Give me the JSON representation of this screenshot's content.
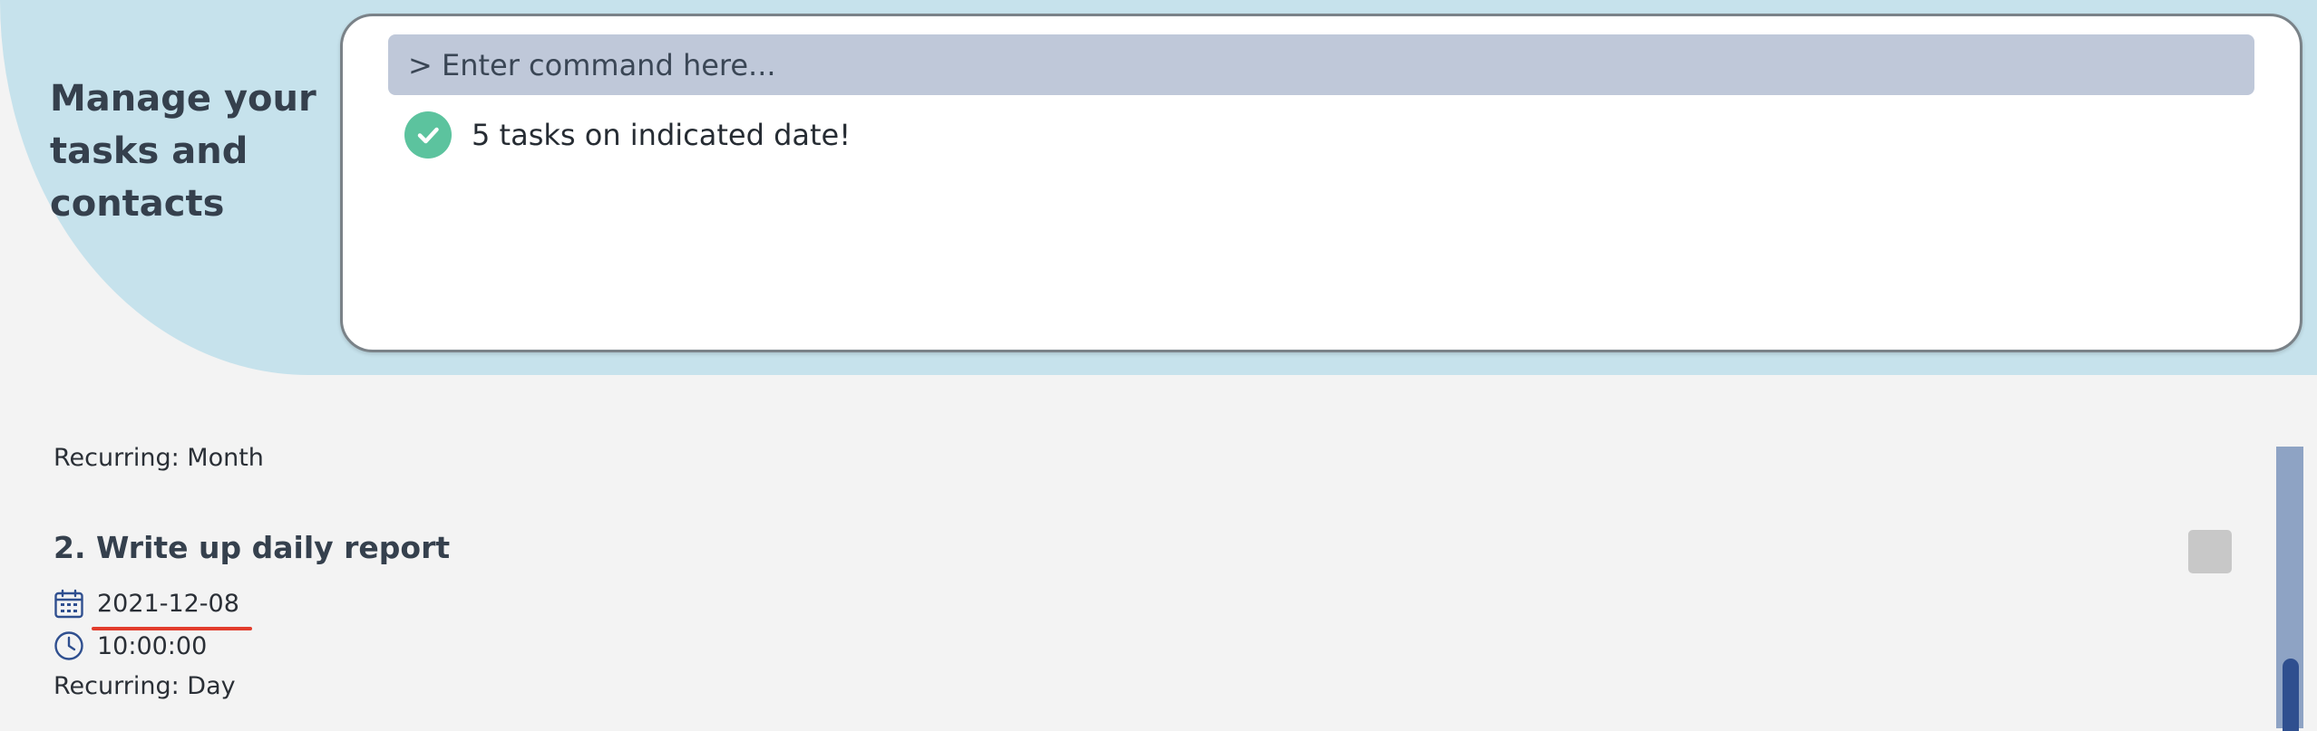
{
  "header": {
    "tagline": "Manage your tasks and contacts"
  },
  "command": {
    "placeholder": "> Enter command here..."
  },
  "result": {
    "icon": "check-circle-icon",
    "message": "5 tasks on indicated date!"
  },
  "tasks": {
    "previous_recurring": "Recurring: Month",
    "items": [
      {
        "title": "2. Write up daily report",
        "date": "2021-12-08",
        "time": "10:00:00",
        "recurring": "Recurring: Day"
      }
    ]
  },
  "colors": {
    "header_band": "#c6e2ec",
    "command_input_bg": "#bfc8d9",
    "success_green": "#5cc39e",
    "date_underline": "#e23c2c",
    "scroll_track": "#8ea3c4",
    "scroll_thumb": "#2f4f8f"
  }
}
